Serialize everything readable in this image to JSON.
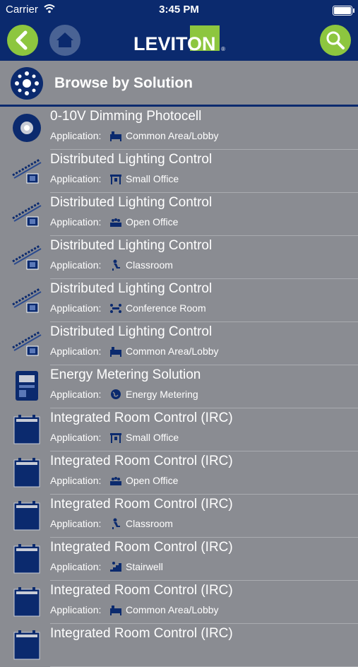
{
  "status_bar": {
    "carrier": "Carrier",
    "time": "3:45 PM"
  },
  "nav": {
    "logo_text": "LEVITON",
    "logo_mark": "®"
  },
  "section": {
    "title": "Browse by Solution"
  },
  "application_label": "Application:",
  "colors": {
    "navy": "#0b2a6e",
    "green": "#8dc63f",
    "background": "#8a8c92"
  },
  "solutions": [
    {
      "title": "0-10V Dimming Photocell",
      "application": "Common Area/Lobby",
      "thumb": "photocell-icon",
      "app_icon": "lobby-icon"
    },
    {
      "title": "Distributed Lighting Control",
      "application": "Small Office",
      "thumb": "distributed-control-icon",
      "app_icon": "small-office-icon"
    },
    {
      "title": "Distributed Lighting Control",
      "application": "Open Office",
      "thumb": "distributed-control-icon",
      "app_icon": "open-office-icon"
    },
    {
      "title": "Distributed Lighting Control",
      "application": "Classroom",
      "thumb": "distributed-control-icon",
      "app_icon": "classroom-icon"
    },
    {
      "title": "Distributed Lighting Control",
      "application": "Conference Room",
      "thumb": "distributed-control-icon",
      "app_icon": "conference-room-icon"
    },
    {
      "title": "Distributed Lighting Control",
      "application": "Common Area/Lobby",
      "thumb": "distributed-control-icon",
      "app_icon": "lobby-icon"
    },
    {
      "title": "Energy Metering Solution",
      "application": "Energy Metering",
      "thumb": "energy-meter-icon",
      "app_icon": "globe-icon"
    },
    {
      "title": "Integrated Room Control (IRC)",
      "application": "Small Office",
      "thumb": "room-controller-icon",
      "app_icon": "small-office-icon"
    },
    {
      "title": "Integrated Room Control (IRC)",
      "application": "Open Office",
      "thumb": "room-controller-icon",
      "app_icon": "open-office-icon"
    },
    {
      "title": "Integrated Room Control (IRC)",
      "application": "Classroom",
      "thumb": "room-controller-icon",
      "app_icon": "classroom-icon"
    },
    {
      "title": "Integrated Room Control (IRC)",
      "application": "Stairwell",
      "thumb": "room-controller-icon",
      "app_icon": "stairwell-icon"
    },
    {
      "title": "Integrated Room Control (IRC)",
      "application": "Common Area/Lobby",
      "thumb": "room-controller-icon",
      "app_icon": "lobby-icon"
    },
    {
      "title": "Integrated Room Control (IRC)",
      "application": "",
      "thumb": "room-controller-icon",
      "app_icon": ""
    }
  ]
}
